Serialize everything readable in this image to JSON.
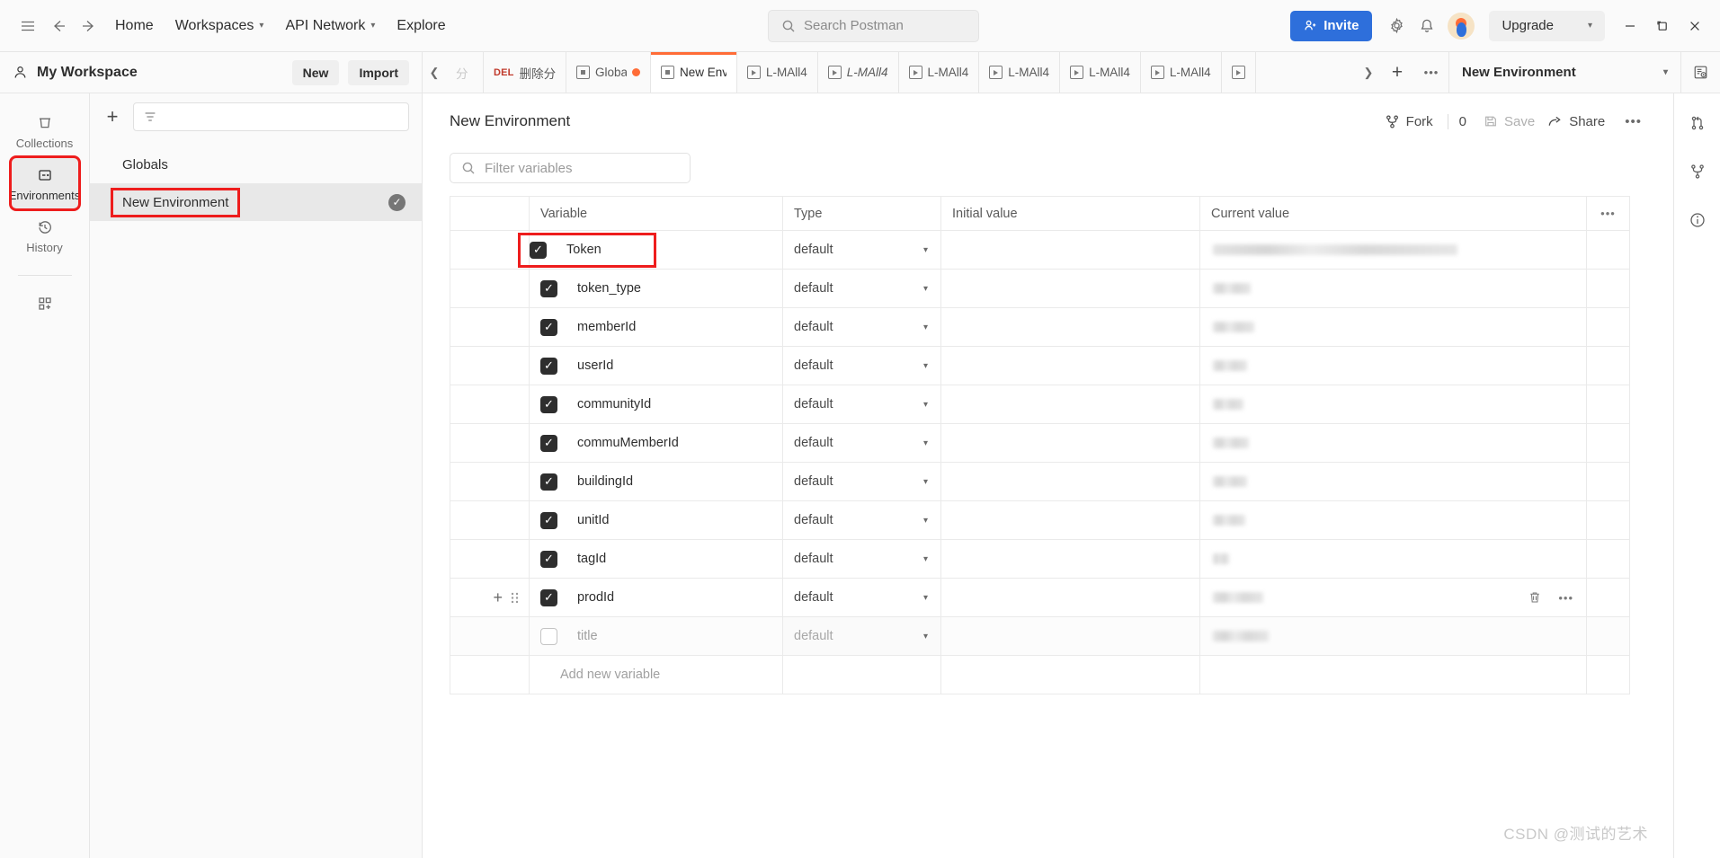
{
  "topbar": {
    "menu_icon": "hamburger-icon",
    "back_icon": "arrow-left-icon",
    "forward_icon": "arrow-right-icon",
    "nav": [
      {
        "label": "Home",
        "caret": false
      },
      {
        "label": "Workspaces",
        "caret": true
      },
      {
        "label": "API Network",
        "caret": true
      },
      {
        "label": "Explore",
        "caret": false
      }
    ],
    "search_placeholder": "Search Postman",
    "invite_label": "Invite",
    "upgrade_label": "Upgrade",
    "settings_icon": "gear-icon",
    "notifications_icon": "bell-icon",
    "minimize_icon": "minimize-icon",
    "maximize_icon": "maximize-icon",
    "close_icon": "close-icon",
    "accent_blue": "#2e6fdb",
    "accent_orange": "#ff6c37"
  },
  "workspace": {
    "name": "My Workspace",
    "new_label": "New",
    "import_label": "Import"
  },
  "rail": {
    "items": [
      {
        "label": "Collections",
        "icon": "collections-icon",
        "active": false,
        "highlight": false
      },
      {
        "label": "Environments",
        "icon": "environments-icon",
        "active": true,
        "highlight": true
      },
      {
        "label": "History",
        "icon": "history-icon",
        "active": false,
        "highlight": false
      }
    ],
    "add_icon": "add-blocks-icon"
  },
  "env_pane": {
    "add_icon": "plus-icon",
    "filter_icon": "filter-icon",
    "items": [
      {
        "label": "Globals",
        "selected": false,
        "active": false,
        "highlight": false
      },
      {
        "label": "New Environment",
        "selected": true,
        "active": true,
        "highlight": true
      }
    ]
  },
  "tabs": {
    "prev_icon": "chevron-left-icon",
    "next_icon": "chevron-right-icon",
    "add_icon": "plus-icon",
    "more_icon": "ellipsis-icon",
    "items": [
      {
        "label": "分",
        "method": "",
        "icon": "request-icon",
        "active": false,
        "italic": false,
        "unsaved": false,
        "partial": true
      },
      {
        "label": "删除分类",
        "method": "DEL",
        "icon": "",
        "active": false,
        "italic": false,
        "unsaved": false
      },
      {
        "label": "Globals",
        "method": "",
        "icon": "environment-icon",
        "active": false,
        "italic": false,
        "unsaved": true
      },
      {
        "label": "New Environment",
        "method": "",
        "icon": "environment-icon",
        "active": true,
        "italic": false,
        "unsaved": false
      },
      {
        "label": "L-MAll4",
        "method": "",
        "icon": "runner-icon",
        "active": false,
        "italic": false,
        "unsaved": false
      },
      {
        "label": "L-MAll4",
        "method": "",
        "icon": "runner-icon",
        "active": false,
        "italic": true,
        "unsaved": false
      },
      {
        "label": "L-MAll4",
        "method": "",
        "icon": "runner-icon",
        "active": false,
        "italic": false,
        "unsaved": false
      },
      {
        "label": "L-MAll4",
        "method": "",
        "icon": "runner-icon",
        "active": false,
        "italic": false,
        "unsaved": false
      },
      {
        "label": "L-MAll4",
        "method": "",
        "icon": "runner-icon",
        "active": false,
        "italic": false,
        "unsaved": false
      },
      {
        "label": "L-MAll4",
        "method": "",
        "icon": "runner-icon",
        "active": false,
        "italic": false,
        "unsaved": false
      },
      {
        "label": "",
        "method": "",
        "icon": "runner-icon",
        "active": false,
        "italic": false,
        "unsaved": false
      }
    ],
    "environment_selector": "New Environment",
    "selector_caret_icon": "chevron-down-icon",
    "eye_icon": "eye-preview-icon"
  },
  "document": {
    "title": "New Environment",
    "fork_label": "Fork",
    "fork_count": "0",
    "save_label": "Save",
    "share_label": "Share",
    "more_icon": "ellipsis-icon",
    "fork_icon": "fork-icon",
    "save_icon": "save-icon",
    "share_icon": "share-icon",
    "filter_placeholder": "Filter variables",
    "search_icon": "search-icon"
  },
  "table": {
    "columns": [
      "Variable",
      "Type",
      "Initial value",
      "Current value"
    ],
    "header_more_icon": "ellipsis-icon",
    "add_new_label": "Add new variable",
    "delete_icon": "trash-icon",
    "row_more_icon": "ellipsis-icon",
    "rows": [
      {
        "checked": true,
        "variable": "Token",
        "type": "default",
        "initial": "",
        "current_redacted": true,
        "current_width": 272,
        "highlight": true,
        "show_actions": false
      },
      {
        "checked": true,
        "variable": "token_type",
        "type": "default",
        "initial": "",
        "current_redacted": true,
        "current_width": 42,
        "highlight": false,
        "show_actions": false
      },
      {
        "checked": true,
        "variable": "memberId",
        "type": "default",
        "initial": "",
        "current_redacted": true,
        "current_width": 46,
        "highlight": false,
        "show_actions": false
      },
      {
        "checked": true,
        "variable": "userId",
        "type": "default",
        "initial": "",
        "current_redacted": true,
        "current_width": 38,
        "highlight": false,
        "show_actions": false
      },
      {
        "checked": true,
        "variable": "communityId",
        "type": "default",
        "initial": "",
        "current_redacted": true,
        "current_width": 34,
        "highlight": false,
        "show_actions": false
      },
      {
        "checked": true,
        "variable": "commuMemberId",
        "type": "default",
        "initial": "",
        "current_redacted": true,
        "current_width": 40,
        "highlight": false,
        "show_actions": false
      },
      {
        "checked": true,
        "variable": "buildingId",
        "type": "default",
        "initial": "",
        "current_redacted": true,
        "current_width": 38,
        "highlight": false,
        "show_actions": false
      },
      {
        "checked": true,
        "variable": "unitId",
        "type": "default",
        "initial": "",
        "current_redacted": true,
        "current_width": 36,
        "highlight": false,
        "show_actions": false
      },
      {
        "checked": true,
        "variable": "tagId",
        "type": "default",
        "initial": "",
        "current_redacted": true,
        "current_width": 18,
        "highlight": false,
        "show_actions": false
      },
      {
        "checked": true,
        "variable": "prodId",
        "type": "default",
        "initial": "",
        "current_redacted": true,
        "current_width": 56,
        "highlight": false,
        "show_actions": true
      },
      {
        "checked": false,
        "variable": "title",
        "type": "default",
        "initial": "",
        "current_redacted": true,
        "current_width": 62,
        "highlight": false,
        "show_actions": false,
        "placeholder": true
      }
    ]
  },
  "right_rail": {
    "items": [
      {
        "icon": "pull-request-icon"
      },
      {
        "icon": "fork-icon"
      },
      {
        "icon": "info-icon"
      }
    ]
  },
  "watermark": "CSDN @测试的艺术"
}
